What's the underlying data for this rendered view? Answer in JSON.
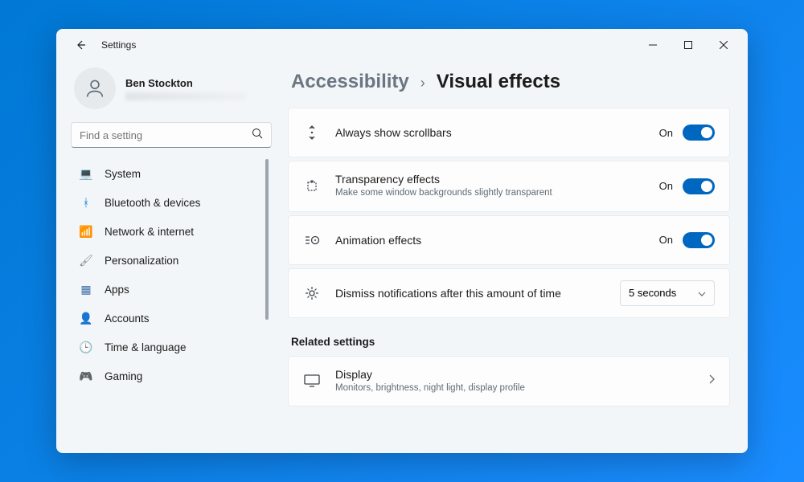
{
  "app_title": "Settings",
  "user": {
    "name": "Ben Stockton"
  },
  "search": {
    "placeholder": "Find a setting"
  },
  "nav": [
    {
      "icon": "💻",
      "color": "#0078d4",
      "label": "System"
    },
    {
      "icon": "ᚼ",
      "color": "#0078d4",
      "label": "Bluetooth & devices"
    },
    {
      "icon": "📶",
      "color": "#0cb0e8",
      "label": "Network & internet"
    },
    {
      "icon": "🖌",
      "color": "#7f8a94",
      "label": "Personalization"
    },
    {
      "icon": "▦",
      "color": "#3c6ea8",
      "label": "Apps"
    },
    {
      "icon": "👤",
      "color": "#2aa08c",
      "label": "Accounts"
    },
    {
      "icon": "🕒",
      "color": "#4a8de0",
      "label": "Time & language"
    },
    {
      "icon": "🎮",
      "color": "#888",
      "label": "Gaming"
    }
  ],
  "breadcrumb": {
    "parent": "Accessibility",
    "sep": "›",
    "current": "Visual effects"
  },
  "cards": [
    {
      "title": "Always show scrollbars",
      "sub": "",
      "state": "On",
      "toggle": true
    },
    {
      "title": "Transparency effects",
      "sub": "Make some window backgrounds slightly transparent",
      "state": "On",
      "toggle": true
    },
    {
      "title": "Animation effects",
      "sub": "",
      "state": "On",
      "toggle": true
    },
    {
      "title": "Dismiss notifications after this amount of time",
      "sub": "",
      "dropdown": "5 seconds"
    }
  ],
  "related": {
    "label": "Related settings",
    "items": [
      {
        "title": "Display",
        "sub": "Monitors, brightness, night light, display profile"
      }
    ]
  }
}
